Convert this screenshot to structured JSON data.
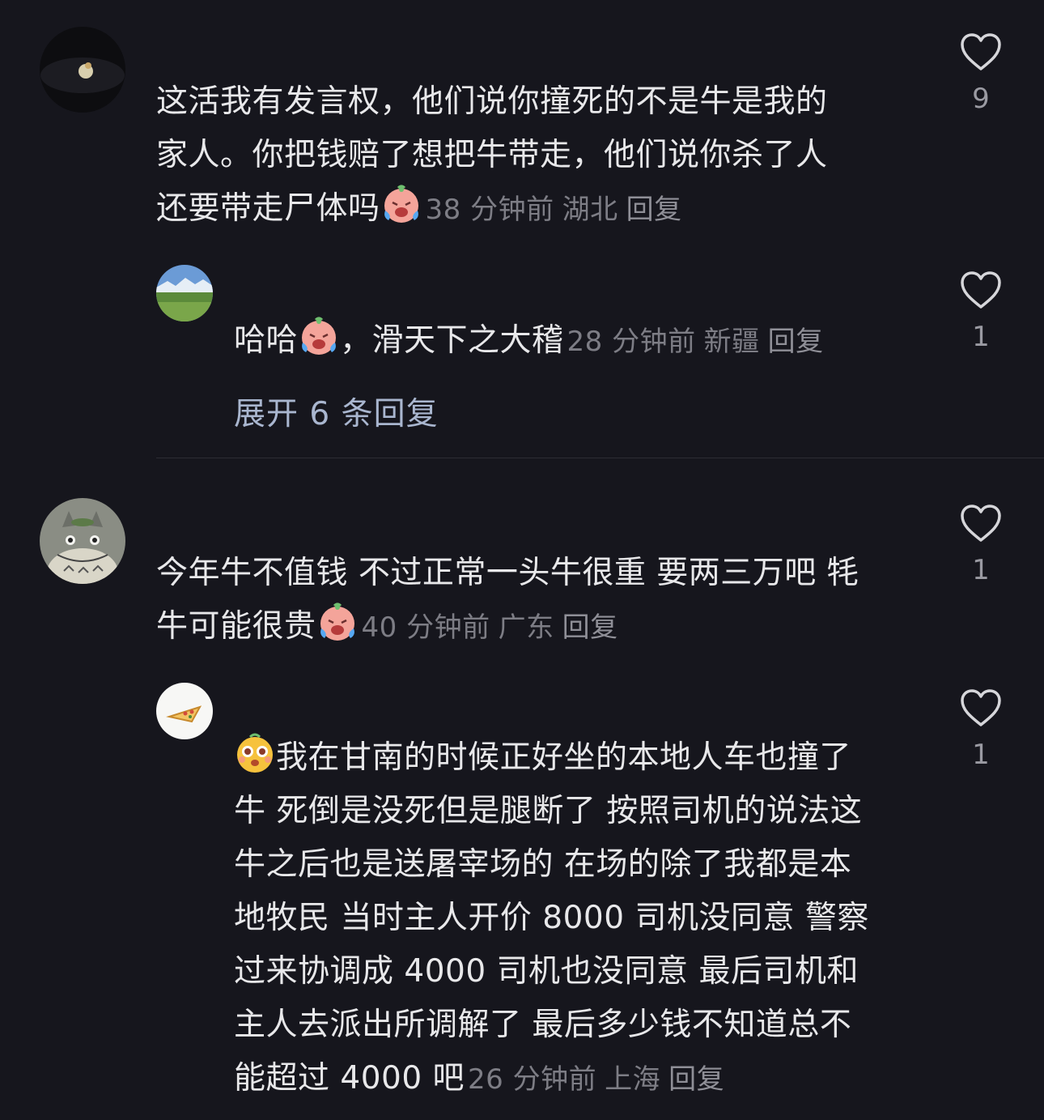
{
  "comments": [
    {
      "lines": [
        "这活我有发言权，他们说你撞死的不是牛是我的",
        "家人。你把钱赔了想把牛带走，他们说你杀了人",
        "还要带走尸体吗"
      ],
      "emoji": "crying-face-emoji",
      "time": "38 分钟前",
      "location": "湖北",
      "reply": "回复",
      "likes": "9"
    },
    {
      "lines_before_emoji": "哈哈",
      "emoji": "crying-face-emoji",
      "lines_after_emoji": "，滑天下之大稽",
      "time": "28 分钟前",
      "location": "新疆",
      "reply": "回复",
      "likes": "1"
    },
    {
      "lines": [
        "今年牛不值钱 不过正常一头牛很重 要两三万吧 牦",
        "牛可能很贵"
      ],
      "emoji": "crying-face-emoji",
      "time": "40 分钟前",
      "location": "广东",
      "reply": "回复",
      "likes": "1"
    },
    {
      "emoji": "surprised-face-emoji",
      "lines": [
        "我在甘南的时候正好坐的本地人车也撞了",
        "牛 死倒是没死但是腿断了 按照司机的说法这",
        "牛之后也是送屠宰场的 在场的除了我都是本",
        "地牧民 当时主人开价 8000 司机没同意 警察",
        "过来协调成 4000 司机也没同意 最后司机和",
        "主人去派出所调解了 最后多少钱不知道总不",
        "能超过 4000 吧"
      ],
      "time": "26 分钟前",
      "location": "上海",
      "reply": "回复",
      "likes": "1"
    }
  ],
  "expand_replies": "展开 6 条回复",
  "colors": {
    "background": "#16161d",
    "text": "#e8e8ea",
    "meta": "#7d7d85",
    "link": "#a9b6cf"
  }
}
